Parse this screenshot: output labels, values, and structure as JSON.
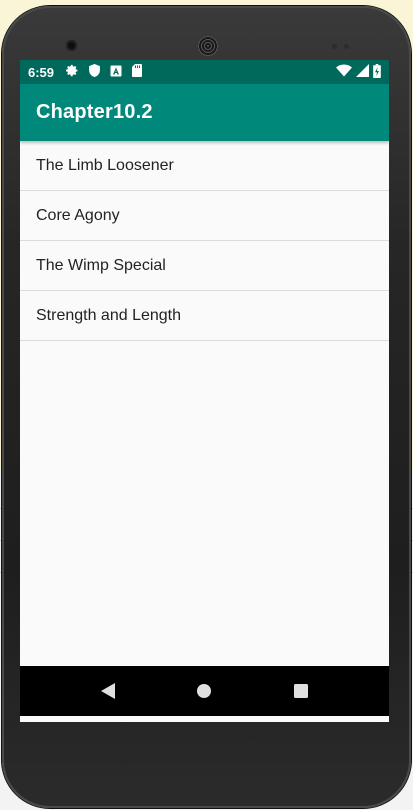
{
  "status_bar": {
    "time": "6:59",
    "left_icons": [
      "gear-icon",
      "shield-icon",
      "a-badge-icon",
      "sd-card-icon"
    ],
    "right_icons": [
      "wifi-icon",
      "cell-signal-icon",
      "battery-icon"
    ],
    "color": "#00695c"
  },
  "app_bar": {
    "title": "Chapter10.2",
    "color": "#00897b"
  },
  "list": {
    "items": [
      {
        "label": "The Limb Loosener"
      },
      {
        "label": "Core Agony"
      },
      {
        "label": "The Wimp Special"
      },
      {
        "label": "Strength and Length"
      }
    ]
  },
  "nav_bar": {
    "buttons": [
      "back-icon",
      "home-icon",
      "recents-icon"
    ]
  }
}
